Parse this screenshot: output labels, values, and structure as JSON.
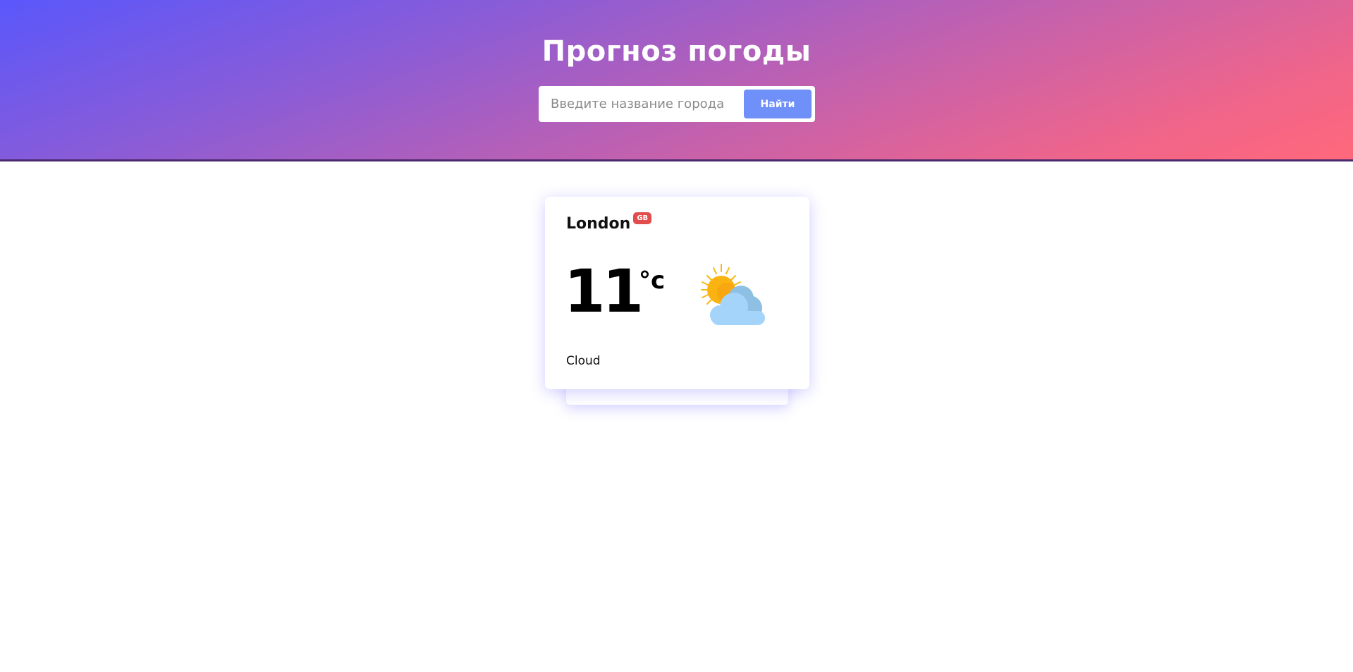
{
  "header": {
    "title": "Прогноз погоды",
    "search": {
      "placeholder": "Введите название города",
      "value": "",
      "button_label": "Найти"
    }
  },
  "weather_card": {
    "city": "London",
    "country_code": "GB",
    "temperature": "11",
    "unit": "°c",
    "condition": "Cloud",
    "icon": "partly-cloudy-icon"
  },
  "colors": {
    "gradient_start": "#5a57fb",
    "gradient_end": "#ff687b",
    "button": "#6f8ff9",
    "badge": "#e14c4c"
  }
}
